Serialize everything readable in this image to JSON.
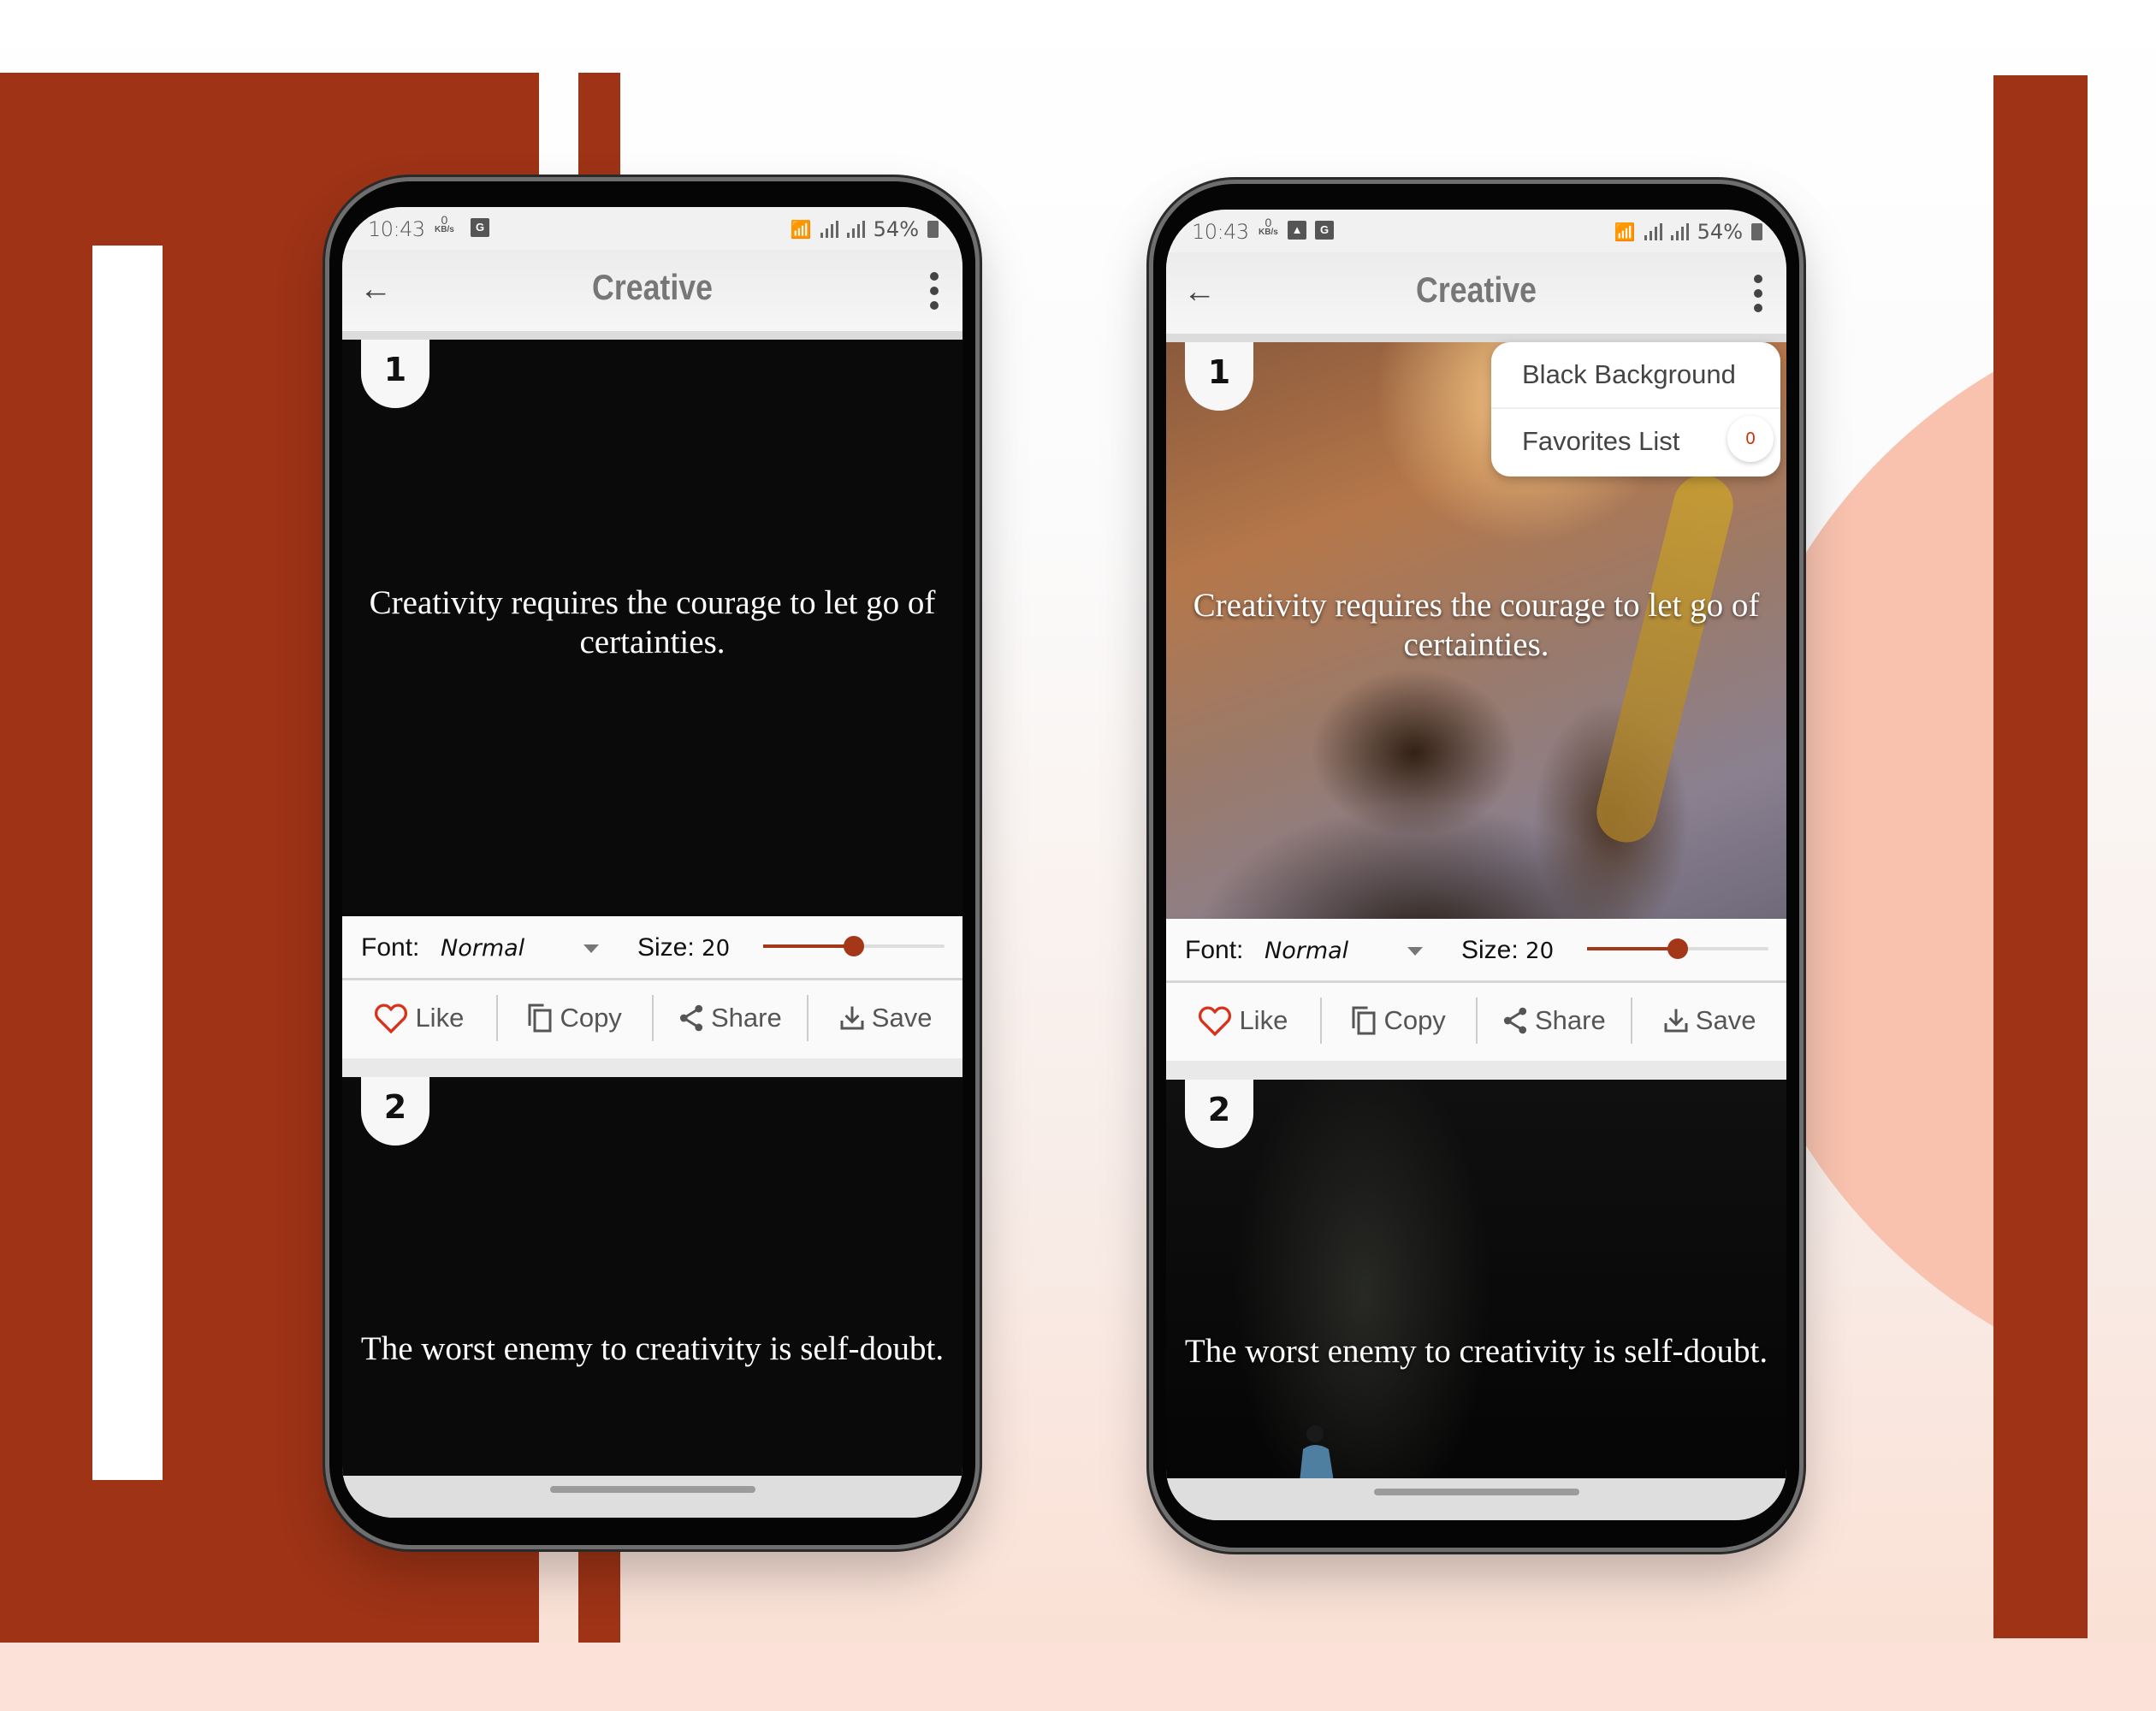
{
  "colors": {
    "brand_red": "#9e3316",
    "accent": "#a33718",
    "like_heart": "#d8321a",
    "peach": "#f8c2ae"
  },
  "phones": [
    {
      "status_bar": {
        "time": "10:43",
        "net_speed": "0",
        "net_unit": "KB/s",
        "icons": [
          "translate-icon"
        ],
        "battery": "54%"
      },
      "app_bar": {
        "title": "Creative",
        "back_icon": "arrow-left-icon",
        "menu_icon": "more-vert-icon"
      },
      "background_mode": "black",
      "cards": [
        {
          "number": "1",
          "quote": "Creativity requires the courage to let go of certainties."
        },
        {
          "number": "2",
          "quote": "The worst enemy to creativity is self-doubt."
        }
      ],
      "controls": {
        "font_label": "Font:",
        "font_value": "Normal",
        "size_label": "Size:",
        "size_value": "20",
        "slider_fraction": 0.5,
        "actions": [
          {
            "label": "Like",
            "icon": "heart-icon"
          },
          {
            "label": "Copy",
            "icon": "copy-icon"
          },
          {
            "label": "Share",
            "icon": "share-icon"
          },
          {
            "label": "Save",
            "icon": "download-icon"
          }
        ]
      }
    },
    {
      "status_bar": {
        "time": "10:43",
        "net_speed": "0",
        "net_unit": "KB/s",
        "icons": [
          "image-icon",
          "translate-icon"
        ],
        "battery": "54%"
      },
      "app_bar": {
        "title": "Creative",
        "back_icon": "arrow-left-icon",
        "menu_icon": "more-vert-icon"
      },
      "background_mode": "photo",
      "cards": [
        {
          "number": "1",
          "quote": "Creativity requires the courage to let go of certainties."
        },
        {
          "number": "2",
          "quote": "The worst enemy to creativity is self-doubt."
        }
      ],
      "controls": {
        "font_label": "Font:",
        "font_value": "Normal",
        "size_label": "Size:",
        "size_value": "20",
        "slider_fraction": 0.5,
        "actions": [
          {
            "label": "Like",
            "icon": "heart-icon"
          },
          {
            "label": "Copy",
            "icon": "copy-icon"
          },
          {
            "label": "Share",
            "icon": "share-icon"
          },
          {
            "label": "Save",
            "icon": "download-icon"
          }
        ]
      },
      "overflow_menu": {
        "items": [
          {
            "label": "Black Background"
          },
          {
            "label": "Favorites List",
            "count": "0"
          }
        ]
      }
    }
  ]
}
